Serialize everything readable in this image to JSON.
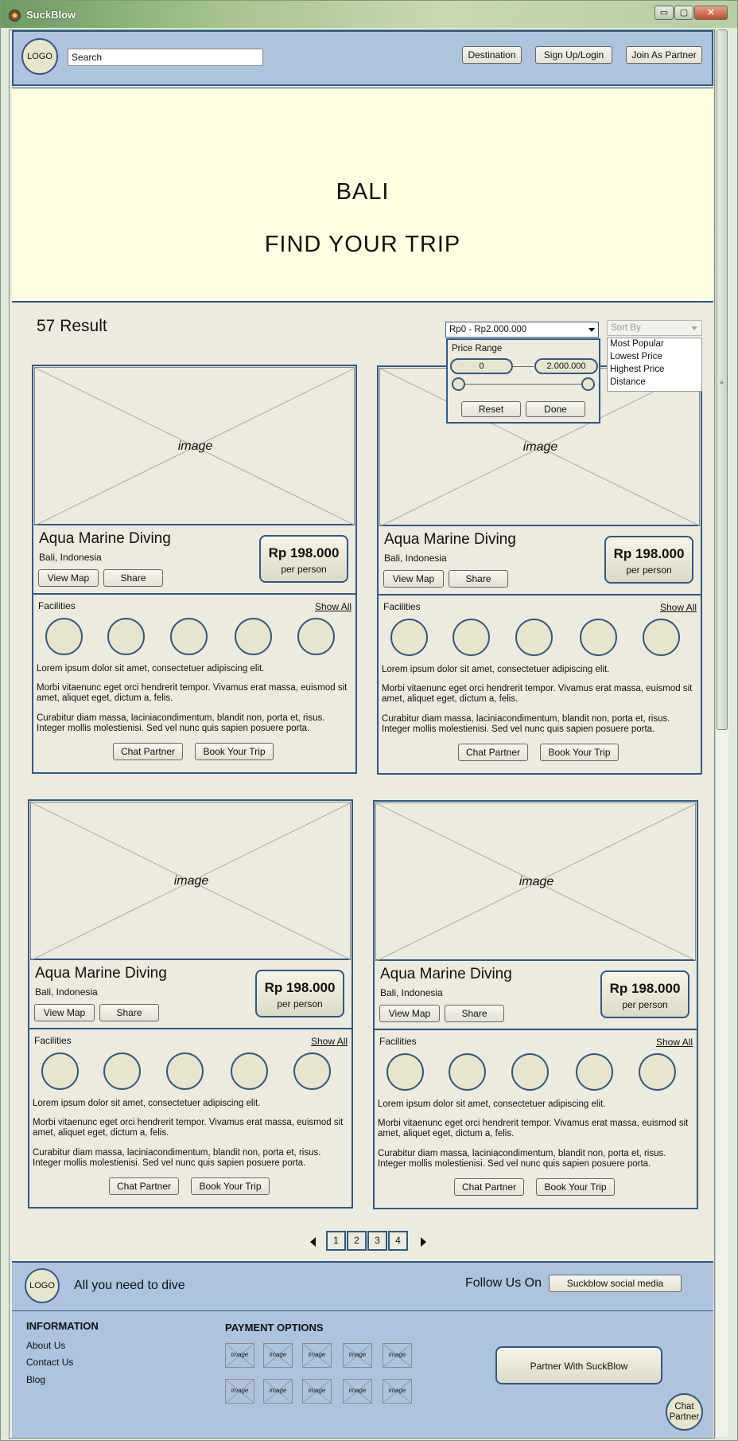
{
  "window": {
    "title": "SuckBlow",
    "min_label": "▭",
    "max_label": "▢",
    "close_label": "✕"
  },
  "header": {
    "logo": "LOGO",
    "search_value": "Search",
    "nav": [
      "Destination",
      "Sign Up/Login",
      "Join As Partner"
    ]
  },
  "hero": {
    "city": "BALI",
    "title": "FIND YOUR TRIP"
  },
  "results": {
    "count_label": "57 Result"
  },
  "filters": {
    "price_select": "Rp0 - Rp2.000.000",
    "price_range_label": "Price Range",
    "min_value": "0",
    "max_value": "2.000.000",
    "reset_label": "Reset",
    "done_label": "Done",
    "sort_placeholder": "Sort By",
    "sort_options": [
      "Most Popular",
      "Lowest Price",
      "Highest Price",
      "Distance"
    ]
  },
  "cards": [
    {
      "image_label": "image",
      "name": "Aqua Marine Diving",
      "location": "Bali, Indonesia",
      "view_map": "View Map",
      "share": "Share",
      "price": "Rp 198.000",
      "per": "per person",
      "facilities_label": "Facilities",
      "show_all": "Show All",
      "p1": "Lorem ipsum dolor sit amet, consectetuer adipiscing elit.",
      "p2": "Morbi vitaenunc eget orci hendrerit tempor. Vivamus erat massa, euismod sit amet, aliquet eget, dictum a, felis.",
      "p3": "Curabitur diam massa, laciniacondimentum, blandit non, porta et, risus. Integer mollis molestienisi. Sed vel nunc quis sapien posuere porta.",
      "chat": "Chat Partner",
      "book": "Book Your Trip"
    },
    {
      "image_label": "image",
      "name": "Aqua Marine Diving",
      "location": "Bali, Indonesia",
      "view_map": "View Map",
      "share": "Share",
      "price": "Rp 198.000",
      "per": "per person",
      "facilities_label": "Facilities",
      "show_all": "Show All",
      "p1": "Lorem ipsum dolor sit amet, consectetuer adipiscing elit.",
      "p2": "Morbi vitaenunc eget orci hendrerit tempor. Vivamus erat massa, euismod sit amet, aliquet eget, dictum a, felis.",
      "p3": "Curabitur diam massa, laciniacondimentum, blandit non, porta et, risus. Integer mollis molestienisi. Sed vel nunc quis sapien posuere porta.",
      "chat": "Chat Partner",
      "book": "Book Your Trip"
    },
    {
      "image_label": "image",
      "name": "Aqua Marine Diving",
      "location": "Bali, Indonesia",
      "view_map": "View Map",
      "share": "Share",
      "price": "Rp 198.000",
      "per": "per person",
      "facilities_label": "Facilities",
      "show_all": "Show All",
      "p1": "Lorem ipsum dolor sit amet, consectetuer adipiscing elit.",
      "p2": "Morbi vitaenunc eget orci hendrerit tempor. Vivamus erat massa, euismod sit amet, aliquet eget, dictum a, felis.",
      "p3": "Curabitur diam massa, laciniacondimentum, blandit non, porta et, risus. Integer mollis molestienisi. Sed vel nunc quis sapien posuere porta.",
      "chat": "Chat Partner",
      "book": "Book Your Trip"
    },
    {
      "image_label": "image",
      "name": "Aqua Marine Diving",
      "location": "Bali, Indonesia",
      "view_map": "View Map",
      "share": "Share",
      "price": "Rp 198.000",
      "per": "per person",
      "facilities_label": "Facilities",
      "show_all": "Show All",
      "p1": "Lorem ipsum dolor sit amet, consectetuer adipiscing elit.",
      "p2": "Morbi vitaenunc eget orci hendrerit tempor. Vivamus erat massa, euismod sit amet, aliquet eget, dictum a, felis.",
      "p3": "Curabitur diam massa, laciniacondimentum, blandit non, porta et, risus. Integer mollis molestienisi. Sed vel nunc quis sapien posuere porta.",
      "chat": "Chat Partner",
      "book": "Book Your Trip"
    }
  ],
  "pagination": {
    "pages": [
      "1",
      "2",
      "3",
      "4"
    ],
    "current": "1"
  },
  "footer": {
    "logo": "LOGO",
    "tagline": "All you need to dive",
    "follow_label": "Follow Us On",
    "social_button": "Suckblow social media",
    "info_heading": "INFORMATION",
    "info_links": [
      "About Us",
      "Contact Us",
      "Blog"
    ],
    "payment_heading": "PAYMENT OPTIONS",
    "payment_image_label": "image",
    "partner_button": "Partner With SuckBlow",
    "chat_bubble": "Chat Partner"
  },
  "colors": {
    "accent": "#2e5a87",
    "header_bg": "#aec3de",
    "hero_bg": "#feffe0",
    "page_bg": "#ecebdd"
  }
}
